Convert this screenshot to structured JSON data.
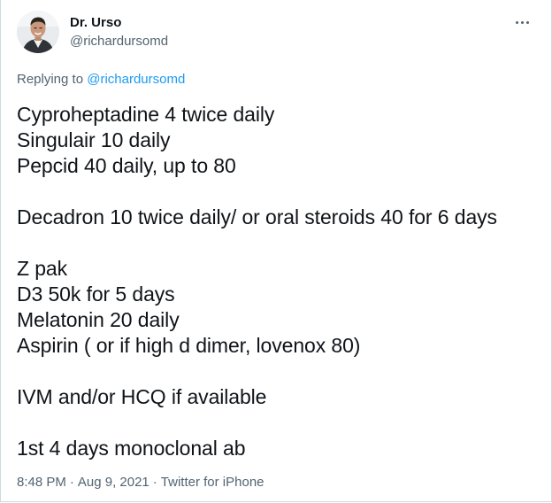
{
  "author": {
    "display_name": "Dr. Urso",
    "handle": "@richardursomd"
  },
  "reply": {
    "prefix": "Replying to ",
    "mention": "@richardursomd"
  },
  "tweet_lines": {
    "l1": "Cyproheptadine 4 twice daily",
    "l2": "Singulair 10 daily",
    "l3": "Pepcid 40 daily, up to 80",
    "l4": "Decadron 10 twice daily/ or oral steroids 40 for 6 days",
    "l5": "Z pak",
    "l6": "D3 50k for 5 days",
    "l7": "Melatonin 20 daily",
    "l8": "Aspirin ( or if high d dimer, lovenox 80)",
    "l9": "IVM and/or HCQ if available",
    "l10": "1st 4 days monoclonal ab"
  },
  "meta": {
    "time": "8:48 PM",
    "separator": "·",
    "date": "Aug 9, 2021",
    "source": "Twitter for iPhone"
  },
  "icons": {
    "more": "more-horizontal-icon"
  },
  "colors": {
    "text_primary": "#0f1419",
    "text_secondary": "#536471",
    "link": "#1d9bf0"
  }
}
